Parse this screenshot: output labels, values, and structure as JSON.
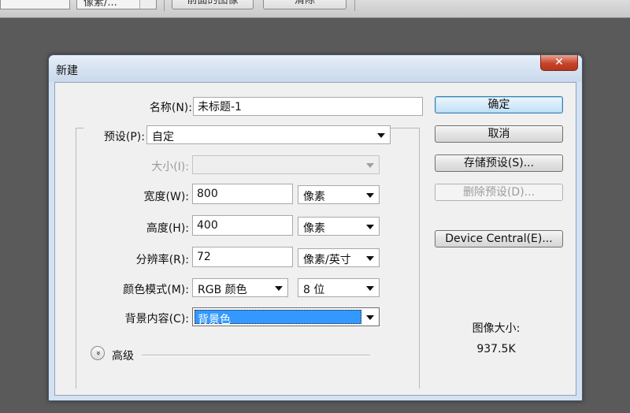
{
  "topbar": {
    "unit_select": "像素/...",
    "front_image_button": "前面的图像",
    "clear_button": "清除"
  },
  "dialog": {
    "title": "新建",
    "close_glyph": "✕",
    "name_label": "名称(N):",
    "name_value": "未标题-1",
    "preset_label": "预设(P):",
    "preset_value": "自定",
    "size_label": "大小(I):",
    "size_value": "",
    "width_label": "宽度(W):",
    "width_value": "800",
    "width_unit": "像素",
    "height_label": "高度(H):",
    "height_value": "400",
    "height_unit": "像素",
    "resolution_label": "分辨率(R):",
    "resolution_value": "72",
    "resolution_unit": "像素/英寸",
    "color_mode_label": "颜色模式(M):",
    "color_mode_value": "RGB 颜色",
    "bit_depth_value": "8 位",
    "bg_contents_label": "背景内容(C):",
    "bg_contents_value": "背景色",
    "advanced_label": "高级",
    "advanced_glyph": "»",
    "buttons": {
      "ok": "确定",
      "cancel": "取消",
      "save_preset": "存储预设(S)...",
      "delete_preset": "删除预设(D)...",
      "device_central": "Device Central(E)..."
    },
    "image_size_label": "图像大小:",
    "image_size_value": "937.5K"
  }
}
